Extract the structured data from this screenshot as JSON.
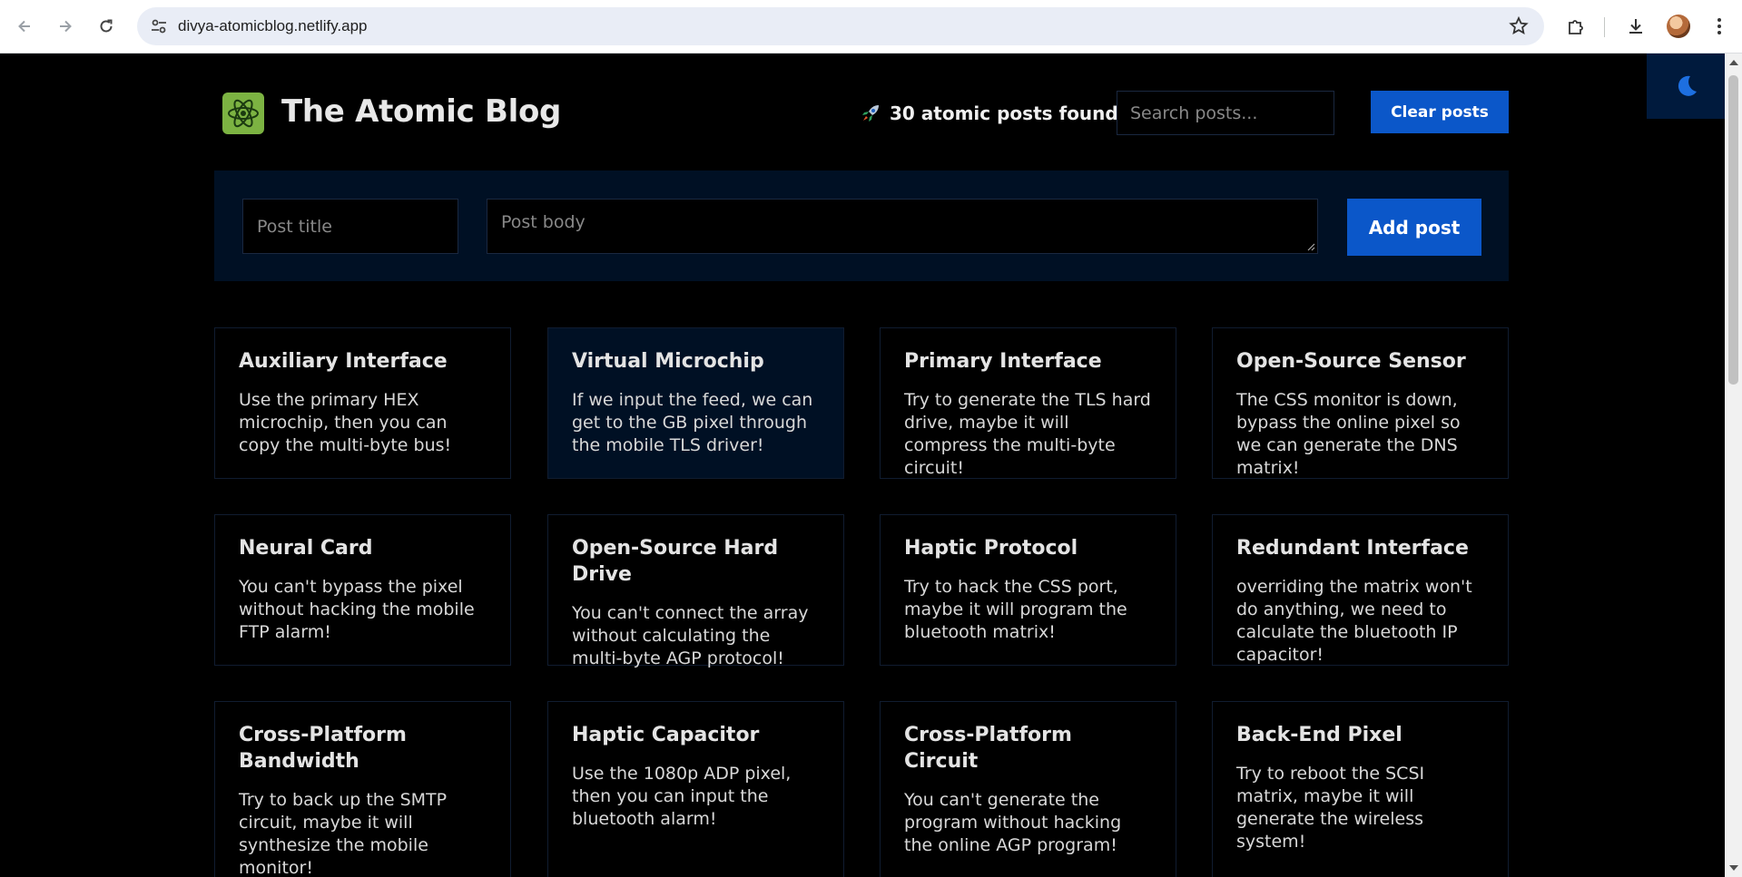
{
  "browser": {
    "url": "divya-atomicblog.netlify.app"
  },
  "header": {
    "title": "The Atomic Blog",
    "count_text": "30 atomic posts found",
    "search_placeholder": "Search posts...",
    "clear_label": "Clear posts"
  },
  "form": {
    "title_placeholder": "Post title",
    "body_placeholder": "Post body",
    "add_label": "Add post"
  },
  "posts": [
    {
      "title": "Auxiliary Interface",
      "body": "Use the primary HEX microchip, then you can copy the multi-byte bus!"
    },
    {
      "title": "Virtual Microchip",
      "body": "If we input the feed, we can get to the GB pixel through the mobile TLS driver!"
    },
    {
      "title": "Primary Interface",
      "body": "Try to generate the TLS hard drive, maybe it will compress the multi-byte circuit!"
    },
    {
      "title": "Open-Source Sensor",
      "body": "The CSS monitor is down, bypass the online pixel so we can generate the DNS matrix!"
    },
    {
      "title": "Neural Card",
      "body": "You can't bypass the pixel without hacking the mobile FTP alarm!"
    },
    {
      "title": "Open-Source Hard Drive",
      "body": "You can't connect the array without calculating the multi-byte AGP protocol!"
    },
    {
      "title": "Haptic Protocol",
      "body": "Try to hack the CSS port, maybe it will program the bluetooth matrix!"
    },
    {
      "title": "Redundant Interface",
      "body": "overriding the matrix won't do anything, we need to calculate the bluetooth IP capacitor!"
    },
    {
      "title": "Cross-Platform Bandwidth",
      "body": "Try to back up the SMTP circuit, maybe it will synthesize the mobile monitor!"
    },
    {
      "title": "Haptic Capacitor",
      "body": "Use the 1080p ADP pixel, then you can input the bluetooth alarm!"
    },
    {
      "title": "Cross-Platform Circuit",
      "body": "You can't generate the program without hacking the online AGP program!"
    },
    {
      "title": "Back-End Pixel",
      "body": "Try to reboot the SCSI matrix, maybe it will generate the wireless system!"
    }
  ],
  "colors": {
    "accent": "#0b57c9",
    "logo_bg": "#7cb342",
    "panel_bg": "#001024"
  },
  "icons": {
    "logo": "atom-icon",
    "count": "rocket-icon",
    "dark_toggle": "moon-icon"
  }
}
